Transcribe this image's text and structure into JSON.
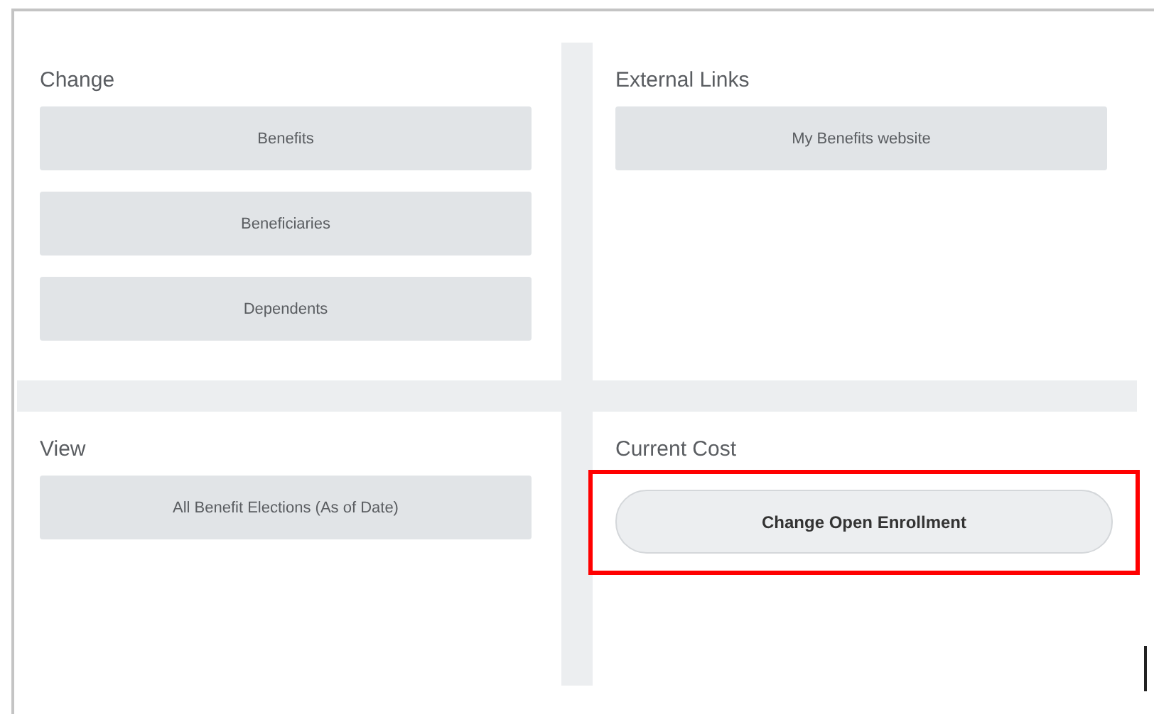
{
  "panels": [
    {
      "title": "Change",
      "buttons": [
        {
          "label": "Benefits",
          "kind": "block",
          "highlighted": false
        },
        {
          "label": "Beneficiaries",
          "kind": "block",
          "highlighted": false
        },
        {
          "label": "Dependents",
          "kind": "block",
          "highlighted": false
        }
      ]
    },
    {
      "title": "External Links",
      "buttons": [
        {
          "label": "My Benefits website",
          "kind": "block",
          "highlighted": false
        }
      ]
    },
    {
      "title": "View",
      "buttons": [
        {
          "label": "All Benefit Elections (As of Date)",
          "kind": "block",
          "highlighted": false
        }
      ]
    },
    {
      "title": "Current Cost",
      "buttons": [
        {
          "label": "Change Open Enrollment",
          "kind": "pill",
          "highlighted": true
        }
      ]
    }
  ]
}
